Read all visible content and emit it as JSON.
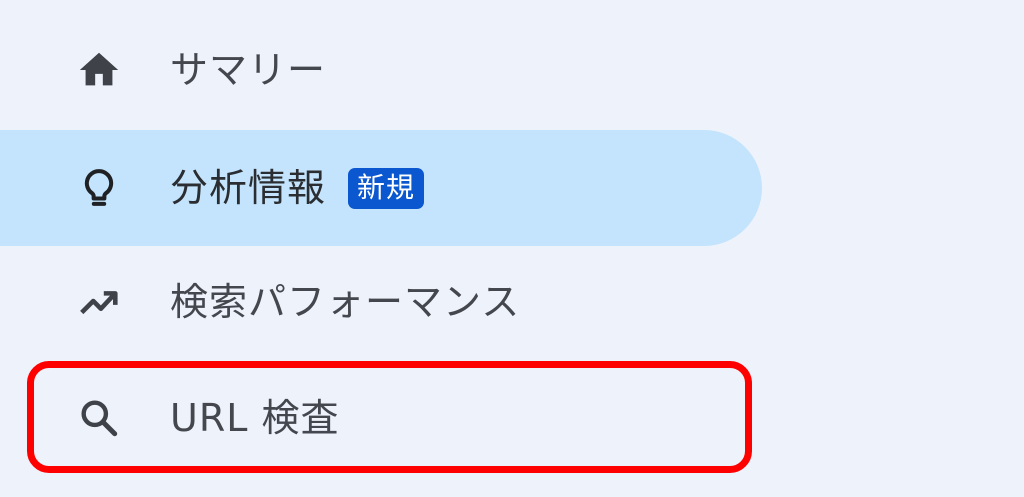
{
  "nav": {
    "items": [
      {
        "id": "summary",
        "label": "サマリー",
        "icon": "home-icon"
      },
      {
        "id": "insights",
        "label": "分析情報",
        "icon": "lightbulb-icon",
        "badge": "新規",
        "selected": true
      },
      {
        "id": "performance",
        "label": "検索パフォーマンス",
        "icon": "trending-up-icon"
      },
      {
        "id": "url-inspection",
        "label": "URL 検査",
        "icon": "search-icon"
      }
    ]
  },
  "colors": {
    "background": "#eef2fb",
    "selected_background": "#c3e4fc",
    "badge_background": "#0b57d0",
    "highlight_border": "#ff0000",
    "text": "#44474d"
  }
}
